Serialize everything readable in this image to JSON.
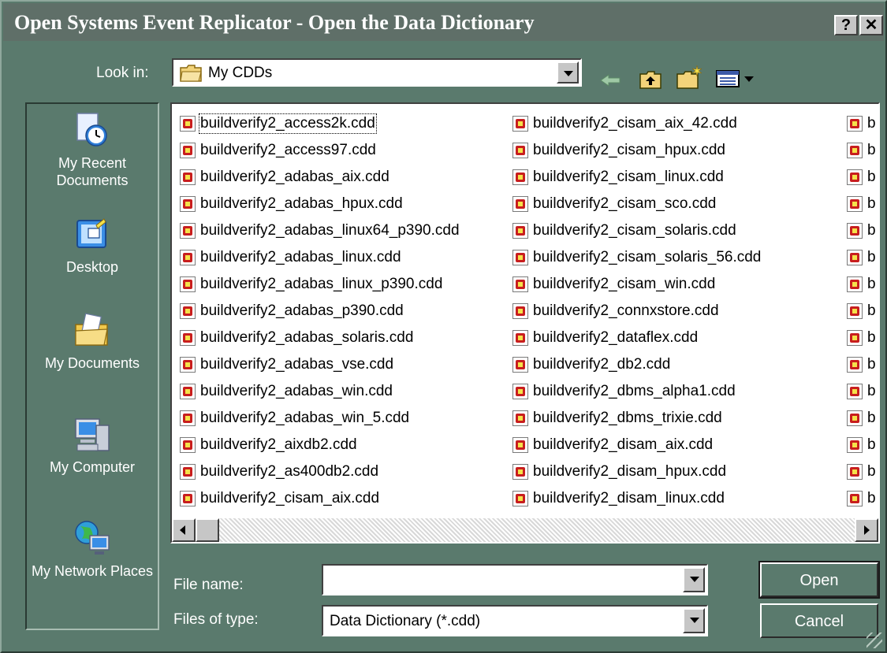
{
  "window": {
    "title": "Open Systems Event Replicator - Open the Data Dictionary",
    "help_glyph": "?",
    "close_glyph": "✕"
  },
  "toolbar": {
    "look_in_label": "Look in:",
    "look_in_value": "My CDDs",
    "icons": [
      "back-arrow-icon",
      "up-folder-icon",
      "new-folder-icon",
      "view-menu-icon"
    ]
  },
  "places": [
    {
      "label": "My Recent Documents",
      "icon": "recent-documents-icon"
    },
    {
      "label": "Desktop",
      "icon": "desktop-icon"
    },
    {
      "label": "My Documents",
      "icon": "my-documents-icon"
    },
    {
      "label": "My Computer",
      "icon": "my-computer-icon"
    },
    {
      "label": "My Network Places",
      "icon": "network-places-icon"
    }
  ],
  "files": {
    "column1": [
      "buildverify2_access2k.cdd",
      "buildverify2_access97.cdd",
      "buildverify2_adabas_aix.cdd",
      "buildverify2_adabas_hpux.cdd",
      "buildverify2_adabas_linux64_p390.cdd",
      "buildverify2_adabas_linux.cdd",
      "buildverify2_adabas_linux_p390.cdd",
      "buildverify2_adabas_p390.cdd",
      "buildverify2_adabas_solaris.cdd",
      "buildverify2_adabas_vse.cdd",
      "buildverify2_adabas_win.cdd",
      "buildverify2_adabas_win_5.cdd",
      "buildverify2_aixdb2.cdd",
      "buildverify2_as400db2.cdd",
      "buildverify2_cisam_aix.cdd"
    ],
    "column2": [
      "buildverify2_cisam_aix_42.cdd",
      "buildverify2_cisam_hpux.cdd",
      "buildverify2_cisam_linux.cdd",
      "buildverify2_cisam_sco.cdd",
      "buildverify2_cisam_solaris.cdd",
      "buildverify2_cisam_solaris_56.cdd",
      "buildverify2_cisam_win.cdd",
      "buildverify2_connxstore.cdd",
      "buildverify2_dataflex.cdd",
      "buildverify2_db2.cdd",
      "buildverify2_dbms_alpha1.cdd",
      "buildverify2_dbms_trixie.cdd",
      "buildverify2_disam_aix.cdd",
      "buildverify2_disam_hpux.cdd",
      "buildverify2_disam_linux.cdd"
    ],
    "column3_partial": "b"
  },
  "form": {
    "file_name_label": "File name:",
    "file_name_value": "",
    "file_type_label": "Files of type:",
    "file_type_value": "Data Dictionary (*.cdd)"
  },
  "buttons": {
    "open": "Open",
    "cancel": "Cancel"
  },
  "colors": {
    "dialog_bg": "#5a7a6d",
    "titlebar_bg": "#5f6f68",
    "file_icon": "#c81e1e"
  }
}
